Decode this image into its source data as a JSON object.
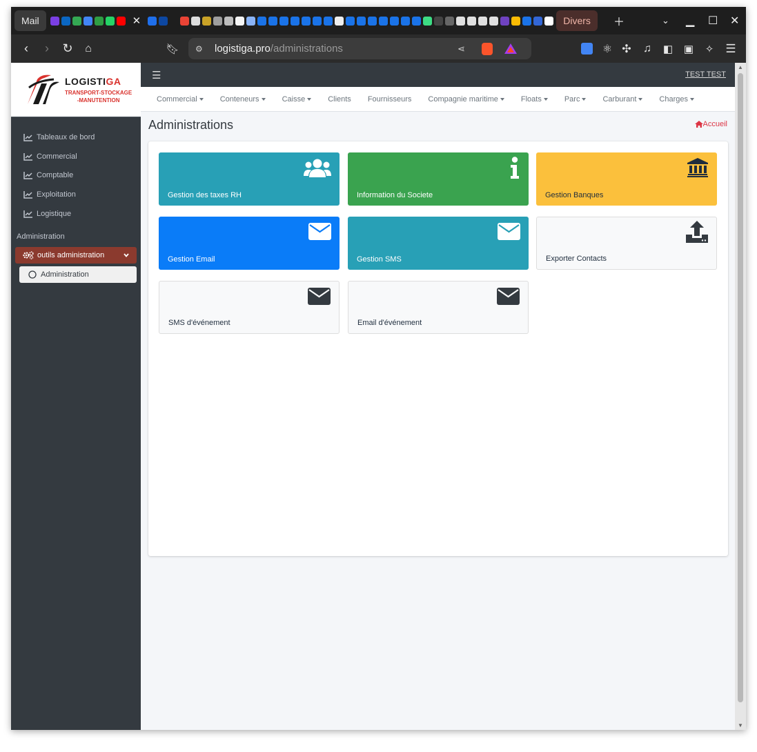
{
  "browser": {
    "tab_mail": "Mail",
    "tab_group": "Divers",
    "url_domain": "logistiga.pro",
    "url_path": "/administrations"
  },
  "sidebar": {
    "brand_name_part1": "LOGISTI",
    "brand_name_part2": "GA",
    "brand_sub_1": "TRANSPORT-STOCKAGE",
    "brand_sub_2": "-MANUTENTION",
    "items": [
      {
        "label": "Tableaux de bord",
        "icon": "chart-line-icon"
      },
      {
        "label": "Commercial",
        "icon": "chart-line-icon"
      },
      {
        "label": "Comptable",
        "icon": "chart-line-icon"
      },
      {
        "label": "Exploitation",
        "icon": "chart-line-icon"
      },
      {
        "label": "Logistique",
        "icon": "chart-line-icon"
      }
    ],
    "section_header": "Administration",
    "active_group": {
      "label": "outils administration",
      "icon": "cogs-icon"
    },
    "active_sub": {
      "label": "Administration",
      "icon": "circle-icon"
    }
  },
  "appbar": {
    "user": "TEST TEST"
  },
  "menu": [
    {
      "label": "Commercial",
      "dropdown": true
    },
    {
      "label": "Conteneurs",
      "dropdown": true
    },
    {
      "label": "Caisse",
      "dropdown": true
    },
    {
      "label": "Clients",
      "dropdown": false
    },
    {
      "label": "Fournisseurs",
      "dropdown": false
    },
    {
      "label": "Compagnie maritime",
      "dropdown": true
    },
    {
      "label": "Floats",
      "dropdown": true
    },
    {
      "label": "Parc",
      "dropdown": true
    },
    {
      "label": "Carburant",
      "dropdown": true
    },
    {
      "label": "Charges",
      "dropdown": true
    }
  ],
  "page": {
    "title": "Administrations",
    "breadcrumb": "Accueil"
  },
  "tiles": [
    {
      "label": "Gestion des taxes RH",
      "icon": "users-icon",
      "color": "#28a0b6"
    },
    {
      "label": "Information du Societe",
      "icon": "info-icon",
      "color": "#3aa34f"
    },
    {
      "label": "Gestion Banques",
      "icon": "bank-icon",
      "color": "#fbc03c"
    },
    {
      "label": "Gestion Email",
      "icon": "envelope-icon",
      "color": "#0a7cf8"
    },
    {
      "label": "Gestion SMS",
      "icon": "envelope-icon",
      "color": "#28a0b6"
    },
    {
      "label": "Exporter Contacts",
      "icon": "upload-icon",
      "color": "#f8f9fa"
    },
    {
      "label": "SMS d'événement",
      "icon": "envelope-icon",
      "color": "#f8f9fa"
    },
    {
      "label": "Email d'événement",
      "icon": "envelope-icon",
      "color": "#f8f9fa"
    }
  ],
  "colors": {
    "sidebar_bg": "#343a40",
    "active_group_bg": "#8b3a2e",
    "brand_red": "#d9322d",
    "breadcrumb_red": "#dc3545"
  }
}
